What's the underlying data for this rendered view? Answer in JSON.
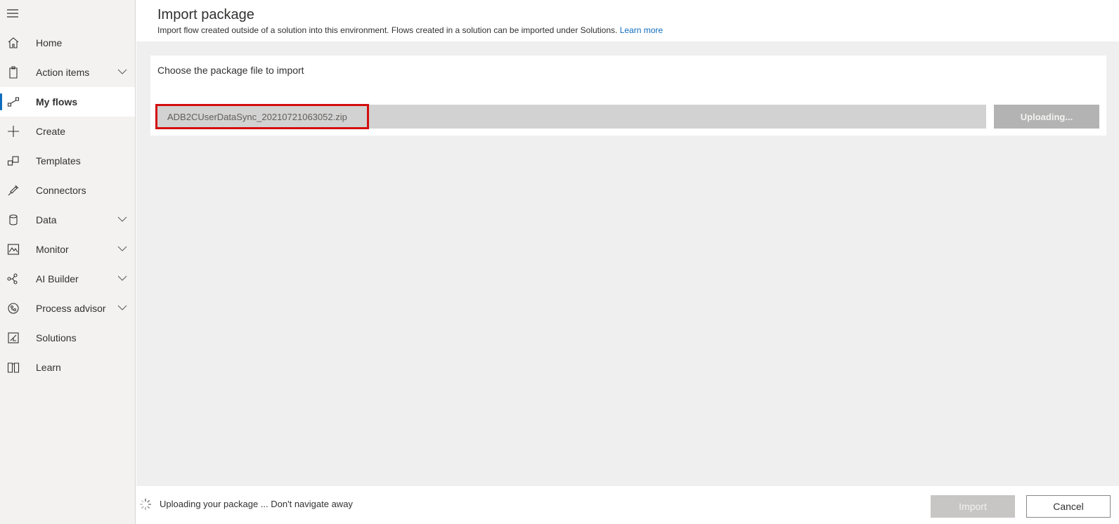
{
  "sidebar": {
    "items": [
      {
        "label": "Home",
        "icon": "home-icon",
        "expandable": false,
        "active": false
      },
      {
        "label": "Action items",
        "icon": "clipboard-icon",
        "expandable": true,
        "active": false
      },
      {
        "label": "My flows",
        "icon": "flow-icon",
        "expandable": false,
        "active": true
      },
      {
        "label": "Create",
        "icon": "plus-icon",
        "expandable": false,
        "active": false
      },
      {
        "label": "Templates",
        "icon": "templates-icon",
        "expandable": false,
        "active": false
      },
      {
        "label": "Connectors",
        "icon": "connector-icon",
        "expandable": false,
        "active": false
      },
      {
        "label": "Data",
        "icon": "database-icon",
        "expandable": true,
        "active": false
      },
      {
        "label": "Monitor",
        "icon": "monitor-icon",
        "expandable": true,
        "active": false
      },
      {
        "label": "AI Builder",
        "icon": "ai-builder-icon",
        "expandable": true,
        "active": false
      },
      {
        "label": "Process advisor",
        "icon": "process-advisor-icon",
        "expandable": true,
        "active": false
      },
      {
        "label": "Solutions",
        "icon": "solutions-icon",
        "expandable": false,
        "active": false
      },
      {
        "label": "Learn",
        "icon": "book-icon",
        "expandable": false,
        "active": false
      }
    ]
  },
  "header": {
    "title": "Import package",
    "subtitle": "Import flow created outside of a solution into this environment. Flows created in a solution can be imported under Solutions.",
    "learn_more": "Learn more"
  },
  "upload": {
    "label": "Choose the package file to import",
    "file_name": "ADB2CUserDataSync_20210721063052.zip",
    "button_label": "Uploading..."
  },
  "footer": {
    "status": "Uploading your package ... Don't navigate away",
    "import_label": "Import",
    "cancel_label": "Cancel"
  },
  "colors": {
    "accent": "#0f6cbd",
    "highlight_border": "#d20d0d",
    "sidebar_bg": "#f3f2f1",
    "main_bg": "#efefef"
  }
}
